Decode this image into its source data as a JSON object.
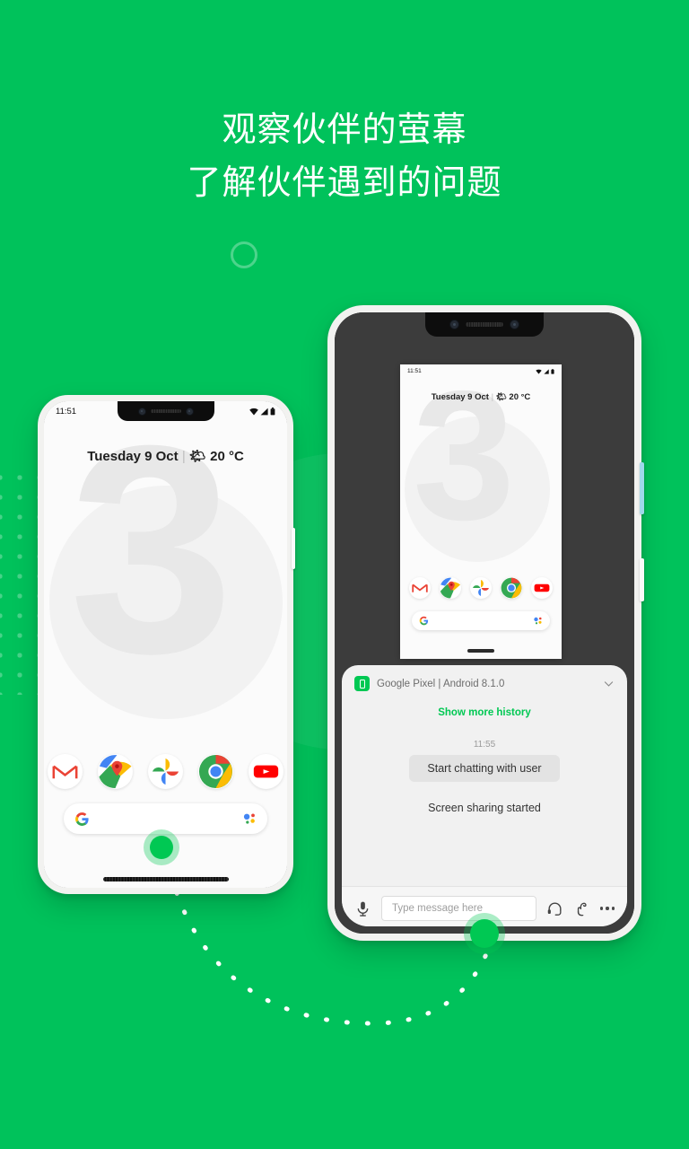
{
  "theme": {
    "background_green": "#00C25B",
    "accent_green": "#00C853",
    "dark_frame": "#0D0D0D",
    "shared_screen_bg": "#3C3C3C"
  },
  "heading": {
    "line1": "观察伙伴的萤幕",
    "line2": "了解伙伴遇到的问题"
  },
  "phone_left": {
    "name": "user-phone",
    "status_bar": {
      "time": "11:51",
      "icons": [
        "wifi-icon",
        "signal-icon",
        "battery-icon"
      ]
    },
    "weather": {
      "date": "Tuesday 9 Oct",
      "separator": "|",
      "icon": "sun-icon",
      "temperature": "20 °C"
    },
    "wallpaper": {
      "numeral": "3"
    },
    "dock_apps": [
      {
        "name": "gmail",
        "label": "Gmail"
      },
      {
        "name": "maps",
        "label": "Google Maps"
      },
      {
        "name": "photos",
        "label": "Google Photos"
      },
      {
        "name": "chrome",
        "label": "Chrome"
      },
      {
        "name": "youtube",
        "label": "YouTube"
      }
    ],
    "search_bar": {
      "logo": "google-g-logo",
      "assistant": "google-assistant-icon"
    }
  },
  "phone_right": {
    "name": "agent-phone",
    "shared_screen": {
      "status_bar": {
        "time": "11:51",
        "icons": [
          "wifi-icon",
          "signal-icon",
          "battery-icon"
        ]
      },
      "weather": {
        "date": "Tuesday 9 Oct",
        "separator": "|",
        "icon": "sun-icon",
        "temperature": "20 °C"
      },
      "wallpaper": {
        "numeral": "3"
      },
      "dock_apps": [
        {
          "name": "gmail",
          "label": "Gmail"
        },
        {
          "name": "maps",
          "label": "Google Maps"
        },
        {
          "name": "photos",
          "label": "Google Photos"
        },
        {
          "name": "chrome",
          "label": "Chrome"
        },
        {
          "name": "youtube",
          "label": "YouTube"
        }
      ],
      "search_bar": {
        "logo": "google-g-logo",
        "assistant": "google-assistant-icon"
      }
    },
    "chat_panel": {
      "device_title": "Google Pixel | Android 8.1.0",
      "collapse_icon": "chevron-down-icon",
      "show_more_history": "Show more history",
      "message_time": "11:55",
      "message_bubble": "Start chatting with user",
      "message_status": "Screen sharing started",
      "toolbar": {
        "mic_icon": "microphone-icon",
        "input_placeholder": "Type message here",
        "headset_icon": "headset-icon",
        "gesture_icon": "hand-pointer-icon",
        "more_icon": "more-options-icon"
      }
    }
  }
}
